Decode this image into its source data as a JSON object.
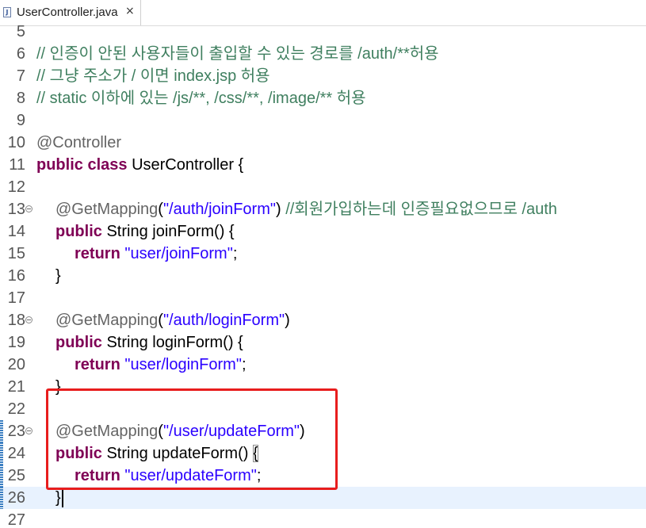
{
  "tab": {
    "file_icon_glyph": "J",
    "file_name": "UserController.java",
    "close_glyph": "×"
  },
  "colors": {
    "comment": "#3f7f5f",
    "keyword": "#7f0055",
    "string": "#2a00ff",
    "annotation": "#646464",
    "highlight_box": "#e81d1d",
    "current_line": "#e8f2fe"
  },
  "editor": {
    "current_line": 26,
    "highlight_lines": [
      23,
      26
    ],
    "lines": [
      {
        "n": "5",
        "fold": false,
        "changed": false,
        "tokens": []
      },
      {
        "n": "6",
        "fold": false,
        "changed": false,
        "tokens": [
          {
            "t": "comment",
            "v": "// 인증이 안된 사용자들이 출입할 수 있는 경로를 /auth/**허용"
          }
        ]
      },
      {
        "n": "7",
        "fold": false,
        "changed": false,
        "tokens": [
          {
            "t": "comment",
            "v": "// 그냥 주소가 / 이면 index.jsp 허용"
          }
        ]
      },
      {
        "n": "8",
        "fold": false,
        "changed": false,
        "tokens": [
          {
            "t": "comment",
            "v": "// static 이하에 있는 /js/**, /css/**, /image/** 허용"
          }
        ]
      },
      {
        "n": "9",
        "fold": false,
        "changed": false,
        "tokens": []
      },
      {
        "n": "10",
        "fold": false,
        "changed": false,
        "tokens": [
          {
            "t": "annotation",
            "v": "@Controller"
          }
        ]
      },
      {
        "n": "11",
        "fold": false,
        "changed": false,
        "tokens": [
          {
            "t": "keyword",
            "v": "public"
          },
          {
            "t": "plain",
            "v": " "
          },
          {
            "t": "keyword",
            "v": "class"
          },
          {
            "t": "plain",
            "v": " UserController {"
          }
        ]
      },
      {
        "n": "12",
        "fold": false,
        "changed": false,
        "tokens": []
      },
      {
        "n": "13",
        "fold": true,
        "changed": false,
        "indent": 1,
        "tokens": [
          {
            "t": "annotation",
            "v": "@GetMapping"
          },
          {
            "t": "plain",
            "v": "("
          },
          {
            "t": "string",
            "v": "\"/auth/joinForm\""
          },
          {
            "t": "plain",
            "v": ") "
          },
          {
            "t": "comment",
            "v": "//회원가입하는데 인증필요없으므로 /auth"
          }
        ]
      },
      {
        "n": "14",
        "fold": false,
        "changed": false,
        "indent": 1,
        "tokens": [
          {
            "t": "keyword",
            "v": "public"
          },
          {
            "t": "plain",
            "v": " String joinForm() {"
          }
        ]
      },
      {
        "n": "15",
        "fold": false,
        "changed": false,
        "indent": 2,
        "tokens": [
          {
            "t": "keyword",
            "v": "return"
          },
          {
            "t": "plain",
            "v": " "
          },
          {
            "t": "string",
            "v": "\"user/joinForm\""
          },
          {
            "t": "plain",
            "v": ";"
          }
        ]
      },
      {
        "n": "16",
        "fold": false,
        "changed": false,
        "indent": 1,
        "tokens": [
          {
            "t": "plain",
            "v": "}"
          }
        ]
      },
      {
        "n": "17",
        "fold": false,
        "changed": false,
        "tokens": []
      },
      {
        "n": "18",
        "fold": true,
        "changed": false,
        "indent": 1,
        "tokens": [
          {
            "t": "annotation",
            "v": "@GetMapping"
          },
          {
            "t": "plain",
            "v": "("
          },
          {
            "t": "string",
            "v": "\"/auth/loginForm\""
          },
          {
            "t": "plain",
            "v": ")"
          }
        ]
      },
      {
        "n": "19",
        "fold": false,
        "changed": false,
        "indent": 1,
        "tokens": [
          {
            "t": "keyword",
            "v": "public"
          },
          {
            "t": "plain",
            "v": " String loginForm() {"
          }
        ]
      },
      {
        "n": "20",
        "fold": false,
        "changed": false,
        "indent": 2,
        "tokens": [
          {
            "t": "keyword",
            "v": "return"
          },
          {
            "t": "plain",
            "v": " "
          },
          {
            "t": "string",
            "v": "\"user/loginForm\""
          },
          {
            "t": "plain",
            "v": ";"
          }
        ]
      },
      {
        "n": "21",
        "fold": false,
        "changed": false,
        "indent": 1,
        "tokens": [
          {
            "t": "plain",
            "v": "}"
          }
        ]
      },
      {
        "n": "22",
        "fold": false,
        "changed": false,
        "tokens": []
      },
      {
        "n": "23",
        "fold": true,
        "changed": true,
        "indent": 1,
        "tokens": [
          {
            "t": "annotation",
            "v": "@GetMapping"
          },
          {
            "t": "plain",
            "v": "("
          },
          {
            "t": "string",
            "v": "\"/user/updateForm\""
          },
          {
            "t": "plain",
            "v": ")"
          }
        ]
      },
      {
        "n": "24",
        "fold": false,
        "changed": true,
        "indent": 1,
        "tokens": [
          {
            "t": "keyword",
            "v": "public"
          },
          {
            "t": "plain",
            "v": " String updateForm() "
          },
          {
            "t": "bracket",
            "v": "{"
          }
        ]
      },
      {
        "n": "25",
        "fold": false,
        "changed": true,
        "indent": 2,
        "tokens": [
          {
            "t": "keyword",
            "v": "return"
          },
          {
            "t": "plain",
            "v": " "
          },
          {
            "t": "string",
            "v": "\"user/updateForm\""
          },
          {
            "t": "plain",
            "v": ";"
          }
        ]
      },
      {
        "n": "26",
        "fold": false,
        "changed": true,
        "indent": 1,
        "caret": true,
        "tokens": [
          {
            "t": "plain",
            "v": "}"
          }
        ]
      },
      {
        "n": "27",
        "fold": false,
        "changed": false,
        "tokens": []
      }
    ]
  }
}
